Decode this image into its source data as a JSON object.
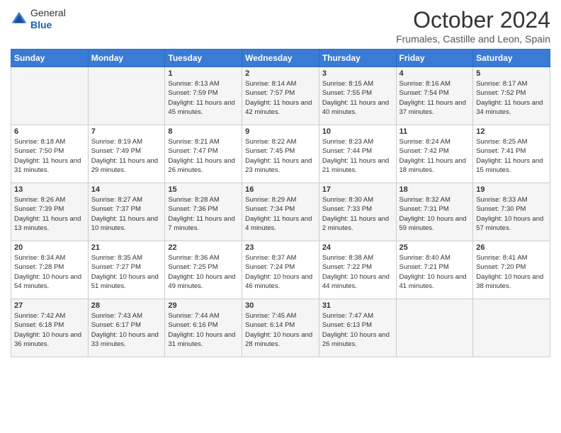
{
  "header": {
    "logo_general": "General",
    "logo_blue": "Blue",
    "month_title": "October 2024",
    "subtitle": "Frumales, Castille and Leon, Spain"
  },
  "days_of_week": [
    "Sunday",
    "Monday",
    "Tuesday",
    "Wednesday",
    "Thursday",
    "Friday",
    "Saturday"
  ],
  "weeks": [
    [
      {
        "day": "",
        "info": ""
      },
      {
        "day": "",
        "info": ""
      },
      {
        "day": "1",
        "info": "Sunrise: 8:13 AM\nSunset: 7:59 PM\nDaylight: 11 hours and 45 minutes."
      },
      {
        "day": "2",
        "info": "Sunrise: 8:14 AM\nSunset: 7:57 PM\nDaylight: 11 hours and 42 minutes."
      },
      {
        "day": "3",
        "info": "Sunrise: 8:15 AM\nSunset: 7:55 PM\nDaylight: 11 hours and 40 minutes."
      },
      {
        "day": "4",
        "info": "Sunrise: 8:16 AM\nSunset: 7:54 PM\nDaylight: 11 hours and 37 minutes."
      },
      {
        "day": "5",
        "info": "Sunrise: 8:17 AM\nSunset: 7:52 PM\nDaylight: 11 hours and 34 minutes."
      }
    ],
    [
      {
        "day": "6",
        "info": "Sunrise: 8:18 AM\nSunset: 7:50 PM\nDaylight: 11 hours and 31 minutes."
      },
      {
        "day": "7",
        "info": "Sunrise: 8:19 AM\nSunset: 7:49 PM\nDaylight: 11 hours and 29 minutes."
      },
      {
        "day": "8",
        "info": "Sunrise: 8:21 AM\nSunset: 7:47 PM\nDaylight: 11 hours and 26 minutes."
      },
      {
        "day": "9",
        "info": "Sunrise: 8:22 AM\nSunset: 7:45 PM\nDaylight: 11 hours and 23 minutes."
      },
      {
        "day": "10",
        "info": "Sunrise: 8:23 AM\nSunset: 7:44 PM\nDaylight: 11 hours and 21 minutes."
      },
      {
        "day": "11",
        "info": "Sunrise: 8:24 AM\nSunset: 7:42 PM\nDaylight: 11 hours and 18 minutes."
      },
      {
        "day": "12",
        "info": "Sunrise: 8:25 AM\nSunset: 7:41 PM\nDaylight: 11 hours and 15 minutes."
      }
    ],
    [
      {
        "day": "13",
        "info": "Sunrise: 8:26 AM\nSunset: 7:39 PM\nDaylight: 11 hours and 13 minutes."
      },
      {
        "day": "14",
        "info": "Sunrise: 8:27 AM\nSunset: 7:37 PM\nDaylight: 11 hours and 10 minutes."
      },
      {
        "day": "15",
        "info": "Sunrise: 8:28 AM\nSunset: 7:36 PM\nDaylight: 11 hours and 7 minutes."
      },
      {
        "day": "16",
        "info": "Sunrise: 8:29 AM\nSunset: 7:34 PM\nDaylight: 11 hours and 4 minutes."
      },
      {
        "day": "17",
        "info": "Sunrise: 8:30 AM\nSunset: 7:33 PM\nDaylight: 11 hours and 2 minutes."
      },
      {
        "day": "18",
        "info": "Sunrise: 8:32 AM\nSunset: 7:31 PM\nDaylight: 10 hours and 59 minutes."
      },
      {
        "day": "19",
        "info": "Sunrise: 8:33 AM\nSunset: 7:30 PM\nDaylight: 10 hours and 57 minutes."
      }
    ],
    [
      {
        "day": "20",
        "info": "Sunrise: 8:34 AM\nSunset: 7:28 PM\nDaylight: 10 hours and 54 minutes."
      },
      {
        "day": "21",
        "info": "Sunrise: 8:35 AM\nSunset: 7:27 PM\nDaylight: 10 hours and 51 minutes."
      },
      {
        "day": "22",
        "info": "Sunrise: 8:36 AM\nSunset: 7:25 PM\nDaylight: 10 hours and 49 minutes."
      },
      {
        "day": "23",
        "info": "Sunrise: 8:37 AM\nSunset: 7:24 PM\nDaylight: 10 hours and 46 minutes."
      },
      {
        "day": "24",
        "info": "Sunrise: 8:38 AM\nSunset: 7:22 PM\nDaylight: 10 hours and 44 minutes."
      },
      {
        "day": "25",
        "info": "Sunrise: 8:40 AM\nSunset: 7:21 PM\nDaylight: 10 hours and 41 minutes."
      },
      {
        "day": "26",
        "info": "Sunrise: 8:41 AM\nSunset: 7:20 PM\nDaylight: 10 hours and 38 minutes."
      }
    ],
    [
      {
        "day": "27",
        "info": "Sunrise: 7:42 AM\nSunset: 6:18 PM\nDaylight: 10 hours and 36 minutes."
      },
      {
        "day": "28",
        "info": "Sunrise: 7:43 AM\nSunset: 6:17 PM\nDaylight: 10 hours and 33 minutes."
      },
      {
        "day": "29",
        "info": "Sunrise: 7:44 AM\nSunset: 6:16 PM\nDaylight: 10 hours and 31 minutes."
      },
      {
        "day": "30",
        "info": "Sunrise: 7:45 AM\nSunset: 6:14 PM\nDaylight: 10 hours and 28 minutes."
      },
      {
        "day": "31",
        "info": "Sunrise: 7:47 AM\nSunset: 6:13 PM\nDaylight: 10 hours and 26 minutes."
      },
      {
        "day": "",
        "info": ""
      },
      {
        "day": "",
        "info": ""
      }
    ]
  ]
}
